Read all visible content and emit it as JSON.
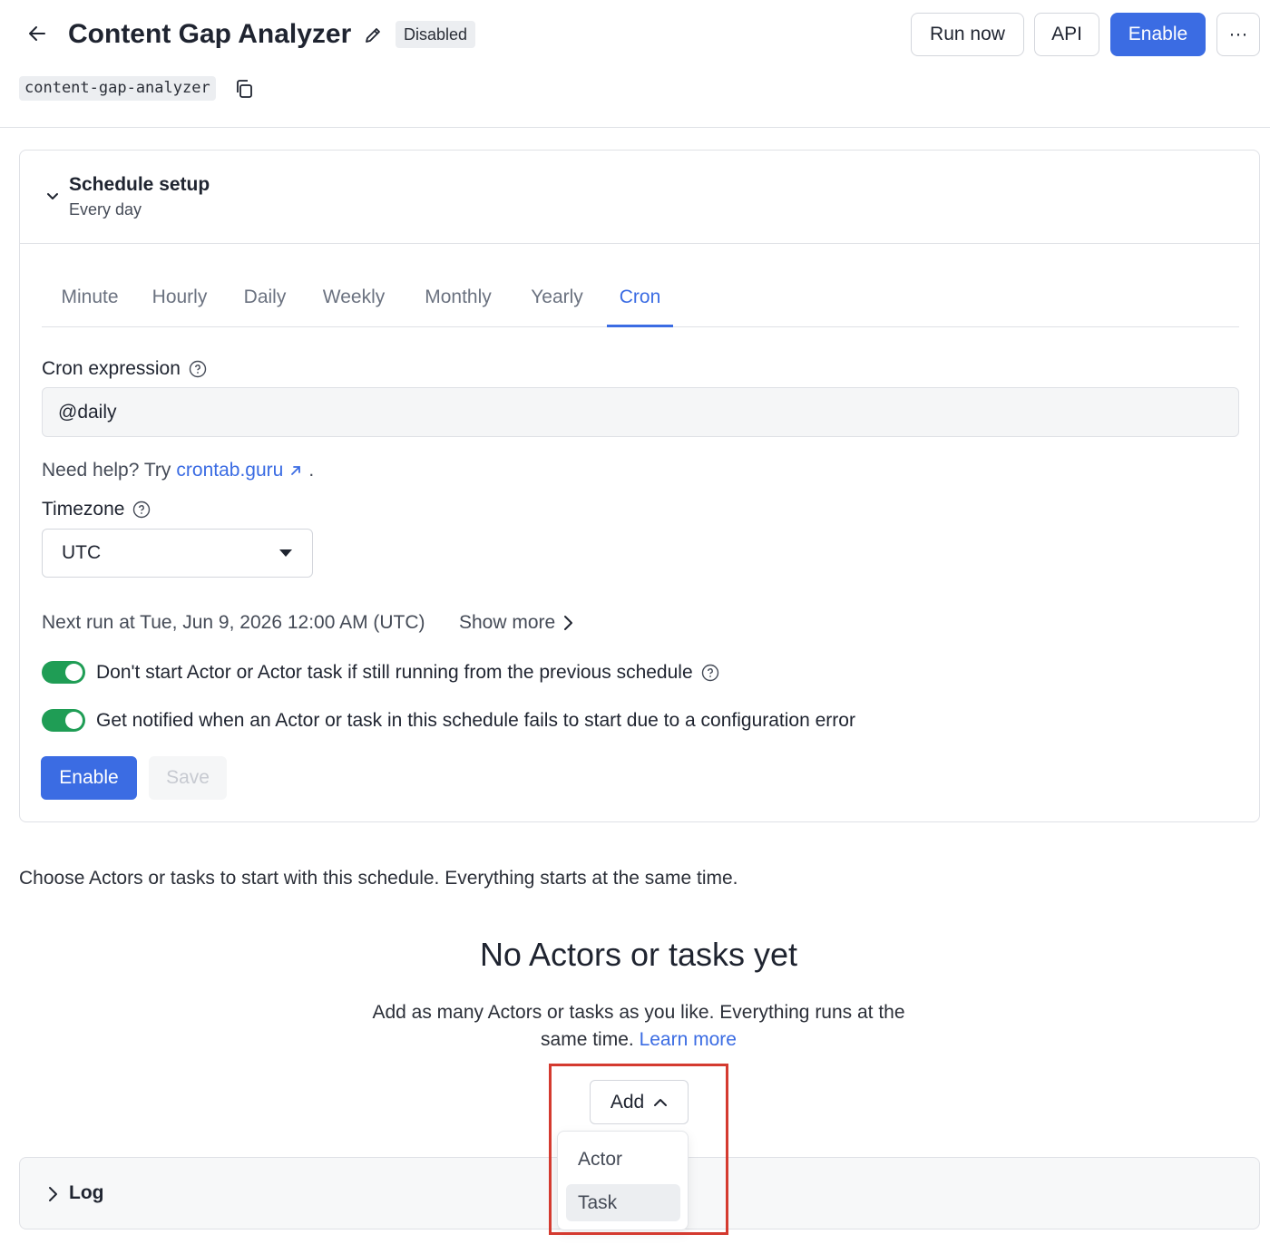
{
  "header": {
    "title": "Content Gap Analyzer",
    "status": "Disabled",
    "slug": "content-gap-analyzer",
    "buttons": {
      "run_now": "Run now",
      "api": "API",
      "enable": "Enable",
      "more": "···"
    }
  },
  "schedule": {
    "title": "Schedule setup",
    "subtitle": "Every day",
    "tabs": [
      {
        "label": "Minute"
      },
      {
        "label": "Hourly"
      },
      {
        "label": "Daily"
      },
      {
        "label": "Weekly"
      },
      {
        "label": "Monthly"
      },
      {
        "label": "Yearly"
      },
      {
        "label": "Cron",
        "active": true
      }
    ],
    "cron_label": "Cron expression",
    "cron_value": "@daily",
    "help_prefix": "Need help? Try",
    "help_link": "crontab.guru",
    "help_suffix": ".",
    "timezone_label": "Timezone",
    "timezone_value": "UTC",
    "next_run": "Next run at Tue, Jun 9, 2026 12:00 AM (UTC)",
    "show_more": "Show more",
    "toggle_1": "Don't start Actor or Actor task if still running from the previous schedule",
    "toggle_2": "Get notified when an Actor or task in this schedule fails to start due to a configuration error",
    "enable_label": "Enable",
    "save_label": "Save"
  },
  "actors": {
    "intro": "Choose Actors or tasks to start with this schedule. Everything starts at the same time.",
    "empty_title": "No Actors or tasks yet",
    "empty_desc": "Add as many Actors or tasks as you like. Everything runs at the same time.",
    "learn_more": "Learn more",
    "add_label": "Add",
    "menu": [
      "Actor",
      "Task"
    ]
  },
  "log": {
    "title": "Log"
  },
  "colors": {
    "accent": "#3b6ce3",
    "toggle_on": "#1f9d55",
    "highlight": "#d43a2f"
  }
}
